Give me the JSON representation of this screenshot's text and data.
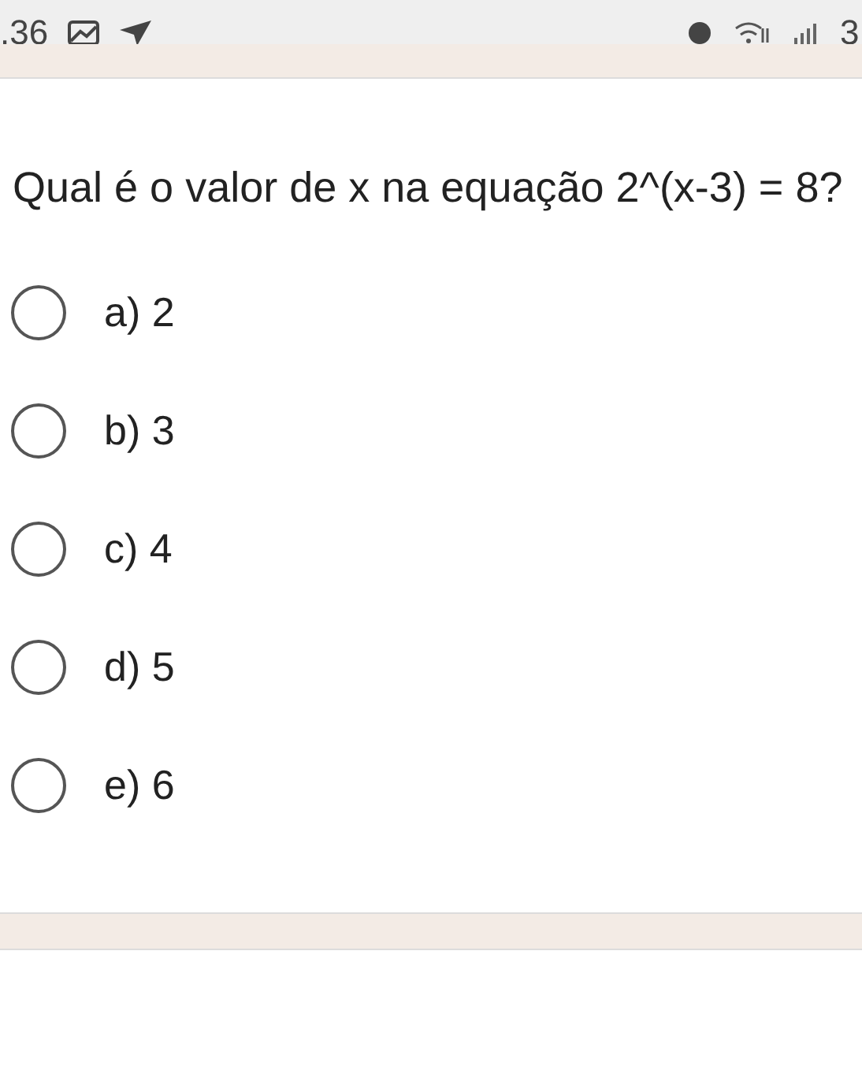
{
  "status_bar": {
    "time": ".36",
    "battery": "3"
  },
  "question": "Qual é o valor de x na equação 2^(x-3) = 8?",
  "options": [
    {
      "label": "a) 2",
      "selected": false
    },
    {
      "label": "b) 3",
      "selected": false
    },
    {
      "label": "c) 4",
      "selected": false
    },
    {
      "label": "d) 5",
      "selected": false
    },
    {
      "label": "e) 6",
      "selected": false
    }
  ]
}
